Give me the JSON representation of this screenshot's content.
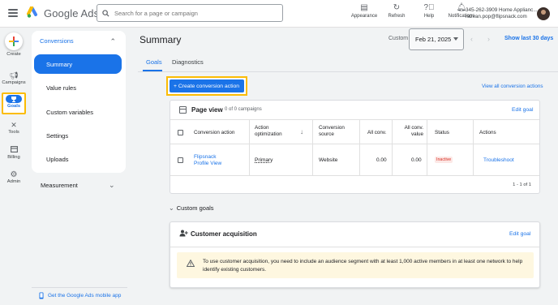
{
  "topbar": {
    "brand": "Google Ads",
    "search_placeholder": "Search for a page or campaign",
    "actions": [
      {
        "label": "Appearance",
        "icon": "appearance-icon"
      },
      {
        "label": "Refresh",
        "icon": "refresh-icon"
      },
      {
        "label": "Help",
        "icon": "help-icon"
      },
      {
        "label": "Notifications",
        "icon": "bell-icon"
      }
    ],
    "account_line1": "345-262-3909 Home Applianc...",
    "account_line2": "razvan.pop@flipsnack.com"
  },
  "rail": {
    "create": "Create",
    "campaigns": "Campaigns",
    "goals": "Goals",
    "tools": "Tools",
    "billing": "Billing",
    "admin": "Admin"
  },
  "sidenav": {
    "section": "Conversions",
    "items": [
      "Summary",
      "Value rules",
      "Custom variables",
      "Settings",
      "Uploads"
    ],
    "measurement": "Measurement",
    "mobile_app": "Get the Google Ads mobile app"
  },
  "header": {
    "title": "Summary",
    "custom_label": "Custom",
    "date": "Feb 21, 2025",
    "show_last": "Show last 30 days"
  },
  "tabs": [
    "Goals",
    "Diagnostics"
  ],
  "create_action": "+ Create conversion action",
  "view_all": "View all conversion actions",
  "page_view": {
    "title": "Page view",
    "count": "0 of 0 campaigns",
    "edit": "Edit goal",
    "columns": {
      "action": "Conversion action",
      "optimization_l1": "Action",
      "optimization_l2": "optimization",
      "source_l1": "Conversion",
      "source_l2": "source",
      "all_conv": "All conv.",
      "all_conv_value_l1": "All conv.",
      "all_conv_value_l2": "value",
      "status": "Status",
      "actions": "Actions"
    },
    "row": {
      "name_l1": "Flipsnack",
      "name_l2": "Profile View",
      "optimization": "Primary",
      "source": "Website",
      "all_conv": "0.00",
      "all_conv_value": "0.00",
      "status": "Inactive",
      "action": "Troubleshoot"
    },
    "pager": "1 - 1 of 1"
  },
  "custom_goals": {
    "label": "Custom goals",
    "card_title": "Customer acquisition",
    "edit": "Edit goal",
    "warning_l1": "To use customer acquisition, you need to include an audience segment with at least 1,000 active members in at least one network to help",
    "warning_l2": "identify existing customers."
  },
  "colors": {
    "primary": "#1a73e8",
    "highlight": "#fbbc04",
    "inactive": "#d93025",
    "warning_bg": "#fef7e0"
  }
}
